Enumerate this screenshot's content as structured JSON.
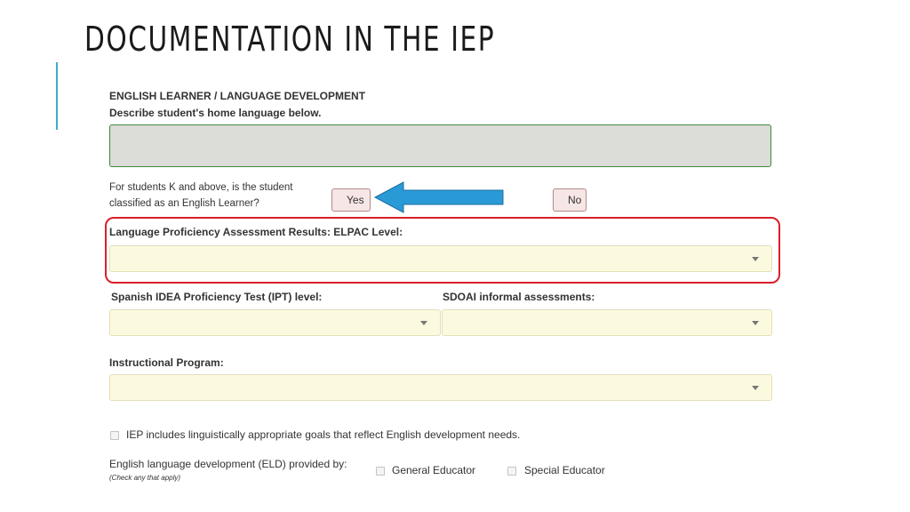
{
  "slide": {
    "title": "DOCUMENTATION IN THE IEP"
  },
  "section": {
    "heading": "ENGLISH LEARNER / LANGUAGE DEVELOPMENT",
    "instruction": "Describe student's home language below."
  },
  "el_question": {
    "line1": "For students K and above, is the student",
    "line2": "classified as an English Learner?",
    "yes_label": "Yes",
    "no_label": "No"
  },
  "elpac": {
    "label": "Language Proficiency Assessment Results: ELPAC Level:"
  },
  "ipt": {
    "label": "Spanish IDEA Proficiency Test (IPT) level:"
  },
  "sdoai": {
    "label": "SDOAI informal assessments:"
  },
  "instructional_program": {
    "label": "Instructional Program:"
  },
  "goals_checkbox": {
    "label": "IEP includes linguistically appropriate goals that reflect English development needs."
  },
  "eld": {
    "label": "English language development (ELD) provided by:",
    "hint": "(Check any that apply)",
    "option1": "General Educator",
    "option2": "Special Educator"
  },
  "colors": {
    "highlight": "#d9202a",
    "arrow": "#2a9ad6",
    "accent": "#3ab0c0"
  }
}
